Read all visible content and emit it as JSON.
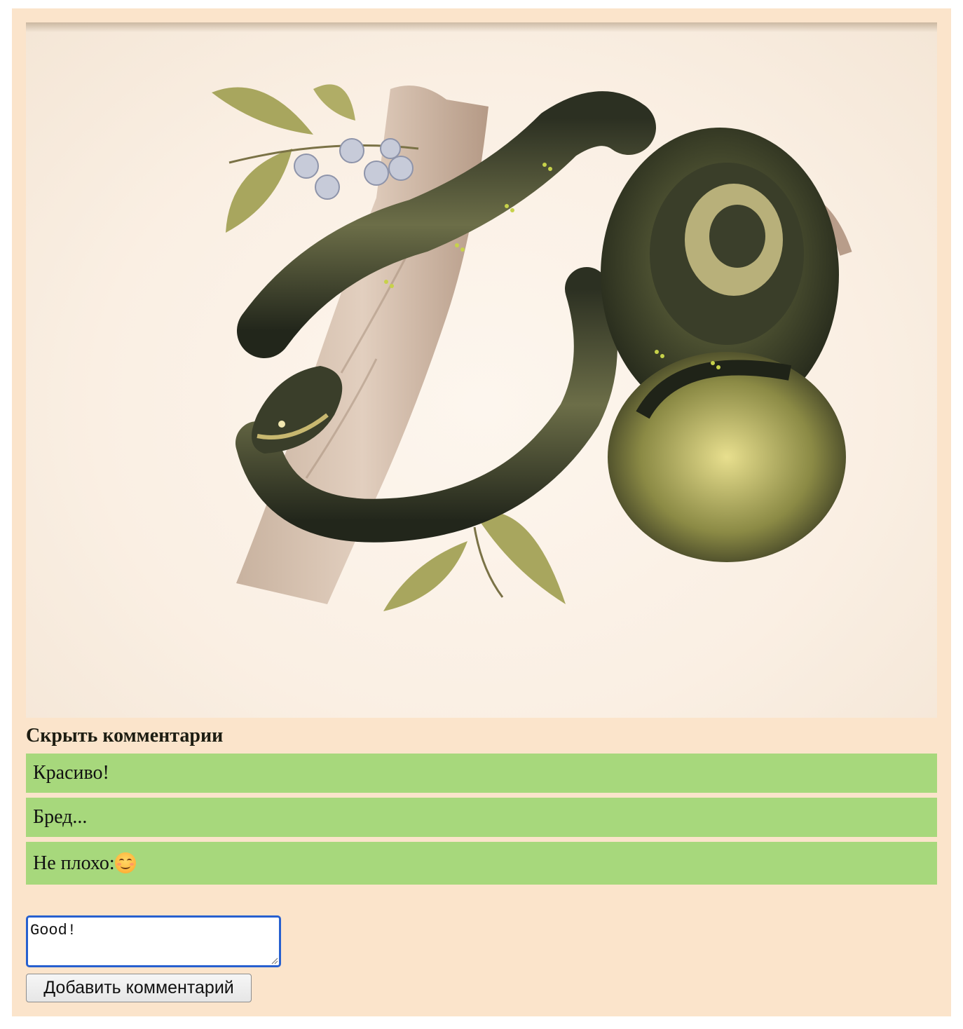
{
  "image": {
    "subject": "coiled green snake on a tree branch"
  },
  "comments_section": {
    "toggle_label": "Скрыть комментарии",
    "comments": [
      {
        "text": "Красиво!"
      },
      {
        "text": "Бред..."
      },
      {
        "text": "Не плохо:",
        "emoji": "smiling-face-icon"
      }
    ]
  },
  "form": {
    "input_value": "Good!",
    "submit_label": "Добавить комментарий"
  },
  "colors": {
    "card_background": "#fbe4cb",
    "comment_background": "#a7d87c",
    "input_focus_border": "#2760cf"
  }
}
